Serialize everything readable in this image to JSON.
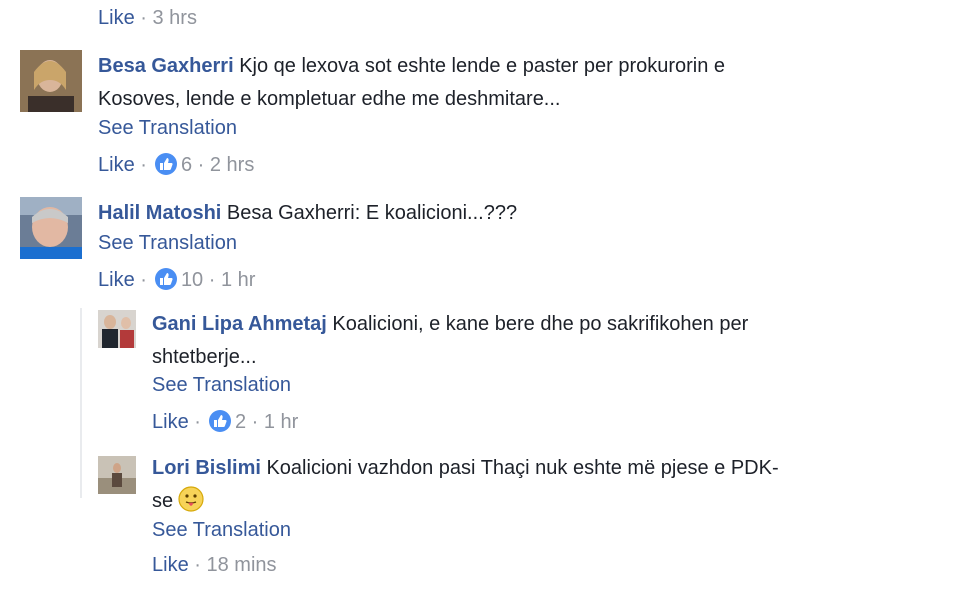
{
  "top_meta": {
    "like": "Like",
    "sep": "·",
    "time": "3 hrs"
  },
  "comments": [
    {
      "author": "Besa Gaxherri",
      "line1": "Kjo qe lexova sot eshte lende e paster per prokurorin e",
      "line2": "Kosoves, lende e kompletuar edhe me deshmitare...",
      "see_translation": "See Translation",
      "like": "Like",
      "sep": "·",
      "reactions": "6",
      "time": "2 hrs"
    },
    {
      "author": "Halil Matoshi",
      "mention": "Besa Gaxherri",
      "text": ": E koalicioni...???",
      "see_translation": "See Translation",
      "like": "Like",
      "sep": "·",
      "reactions": "10",
      "time": "1 hr"
    }
  ],
  "replies": [
    {
      "author": "Gani Lipa Ahmetaj",
      "line1": "Koalicioni, e kane bere dhe po sakrifikohen per",
      "line2": "shtetberje...",
      "see_translation": "See Translation",
      "like": "Like",
      "sep": "·",
      "reactions": "2",
      "time": "1 hr"
    },
    {
      "author": "Lori Bislimi",
      "line1": "Koalicioni vazhdon pasi Thaçi nuk eshte më pjese e PDK-",
      "line2": "se",
      "emoji": "tongue-out-emoji",
      "see_translation": "See Translation",
      "like": "Like",
      "sep": "·",
      "time": "18 mins"
    }
  ],
  "colors": {
    "link": "#365899",
    "meta": "#90949c",
    "text": "#1d2129",
    "like_badge": "#4a8ef3"
  }
}
